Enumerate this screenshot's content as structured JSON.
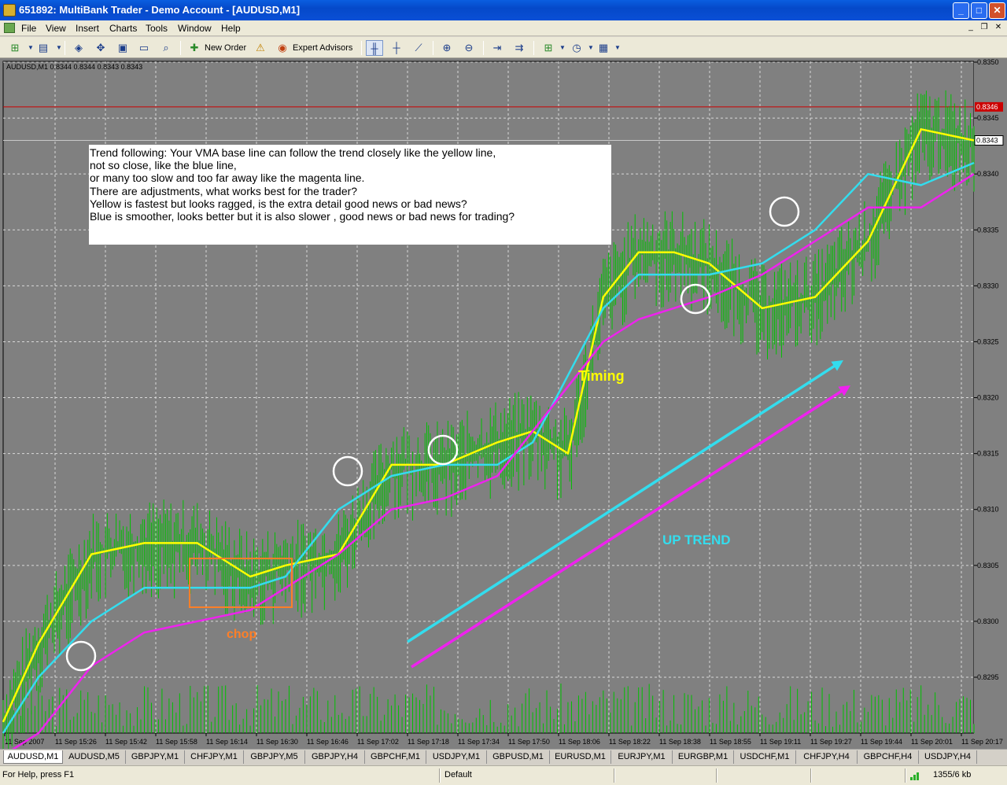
{
  "window": {
    "title": "651892: MultiBank Trader - Demo Account - [AUDUSD,M1]",
    "min": "_",
    "max": "□",
    "close": "✕"
  },
  "menu": [
    "File",
    "View",
    "Insert",
    "Charts",
    "Tools",
    "Window",
    "Help"
  ],
  "toolbar": {
    "new_order": "New Order",
    "expert_advisors": "Expert Advisors"
  },
  "chart": {
    "symbol_info": "AUDUSD,M1  0.8344 0.8344 0.8343 0.8343",
    "price_labels": [
      "0.8350",
      "0.8345",
      "0.8340",
      "0.8335",
      "0.8330",
      "0.8325",
      "0.8320",
      "0.8315",
      "0.8310",
      "0.8305",
      "0.8300",
      "0.8295"
    ],
    "red_line_price": "0.8346",
    "current_price": "0.8343",
    "time_labels": [
      "11 Sep 2007",
      "11 Sep 15:26",
      "11 Sep 15:42",
      "11 Sep 15:58",
      "11 Sep 16:14",
      "11 Sep 16:30",
      "11 Sep 16:46",
      "11 Sep 17:02",
      "11 Sep 17:18",
      "11 Sep 17:34",
      "11 Sep 17:50",
      "11 Sep 18:06",
      "11 Sep 18:22",
      "11 Sep 18:38",
      "11 Sep 18:55",
      "11 Sep 19:11",
      "11 Sep 19:27",
      "11 Sep 19:44",
      "11 Sep 20:01",
      "11 Sep 20:17"
    ],
    "note_lines": [
      "Trend following: Your VMA base line can follow the trend closely like the yellow line,",
      "not so close, like the blue line,",
      "or many too slow and too far away like the magenta line.",
      "There are adjustments, what works best for the trader?",
      "Yellow is fastest but looks ragged, is the extra detail good news or bad news?",
      "Blue is smoother, looks better but it is also slower , good news or bad news for trading?"
    ],
    "annotations": {
      "chop": "chop",
      "timing": "Timing",
      "uptrend": "UP TREND"
    },
    "colors": {
      "background": "#808080",
      "bars": "#00c000",
      "yellow": "#ffff00",
      "cyan": "#33ddee",
      "magenta": "#ee22ee",
      "chop": "#ff7f27",
      "timing": "#ffff00",
      "uptrend": "#33ddee"
    }
  },
  "chart_data": {
    "type": "line",
    "series": [
      {
        "name": "",
        "x": [
          0,
          10,
          25,
          40,
          55,
          70,
          80,
          95,
          110,
          125,
          140,
          150,
          160,
          170,
          180,
          190,
          200,
          215,
          230,
          245,
          260,
          275
        ],
        "y": [
          0.8291,
          0.8298,
          0.8306,
          0.8307,
          0.8307,
          0.8304,
          0.8305,
          0.8306,
          0.8314,
          0.8314,
          0.8316,
          0.8317,
          0.8315,
          0.8329,
          0.8333,
          0.8333,
          0.8332,
          0.8328,
          0.8329,
          0.8334,
          0.8344,
          0.8343
        ]
      },
      {
        "name": "",
        "x": [
          0,
          10,
          25,
          40,
          55,
          70,
          80,
          95,
          110,
          125,
          140,
          150,
          160,
          170,
          180,
          190,
          200,
          215,
          230,
          245,
          260,
          275
        ],
        "y": [
          0.829,
          0.8295,
          0.83,
          0.8303,
          0.8303,
          0.8303,
          0.8304,
          0.831,
          0.8313,
          0.8314,
          0.8314,
          0.8316,
          0.8322,
          0.8328,
          0.8331,
          0.8331,
          0.8331,
          0.8332,
          0.8335,
          0.834,
          0.8339,
          0.8341
        ]
      },
      {
        "name": "",
        "x": [
          0,
          10,
          25,
          40,
          55,
          70,
          80,
          95,
          110,
          125,
          140,
          150,
          160,
          170,
          180,
          190,
          200,
          215,
          230,
          245,
          260,
          275
        ],
        "y": [
          0.8288,
          0.829,
          0.8296,
          0.8299,
          0.83,
          0.8301,
          0.8303,
          0.8306,
          0.831,
          0.8311,
          0.8313,
          0.8317,
          0.8321,
          0.8325,
          0.8327,
          0.8328,
          0.8329,
          0.8331,
          0.8334,
          0.8337,
          0.8337,
          0.834
        ]
      }
    ],
    "ylim": [
      0.829,
      0.835
    ],
    "xlabel": "",
    "ylabel": ""
  },
  "tabs": [
    "AUDUSD,M1",
    "AUDUSD,M5",
    "GBPJPY,M1",
    "CHFJPY,M1",
    "GBPJPY,M5",
    "GBPJPY,H4",
    "GBPCHF,M1",
    "USDJPY,M1",
    "GBPUSD,M1",
    "EURUSD,M1",
    "EURJPY,M1",
    "EURGBP,M1",
    "USDCHF,M1",
    "CHFJPY,H4",
    "GBPCHF,H4",
    "USDJPY,H4"
  ],
  "status": {
    "help": "For Help, press F1",
    "profile": "Default",
    "traffic": "1355/6 kb"
  }
}
